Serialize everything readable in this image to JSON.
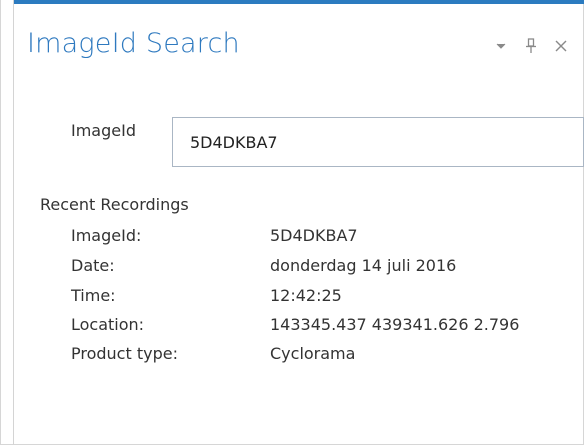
{
  "pane": {
    "title": "ImageId Search",
    "controls": {
      "menu_icon": "chevron-down-icon",
      "pin_icon": "pin-icon",
      "close_icon": "close-icon"
    },
    "accent_color": "#2b7bc0"
  },
  "search": {
    "label": "ImageId",
    "value": "5D4DKBA7"
  },
  "recent": {
    "title": "Recent Recordings",
    "rows": [
      {
        "key": "ImageId:",
        "value": "5D4DKBA7"
      },
      {
        "key": "Date:",
        "value": "donderdag 14 juli 2016"
      },
      {
        "key": "Time:",
        "value": "12:42:25"
      },
      {
        "key": "Location:",
        "value": "143345.437 439341.626 2.796"
      },
      {
        "key": "Product type:",
        "value": "Cyclorama"
      }
    ]
  }
}
